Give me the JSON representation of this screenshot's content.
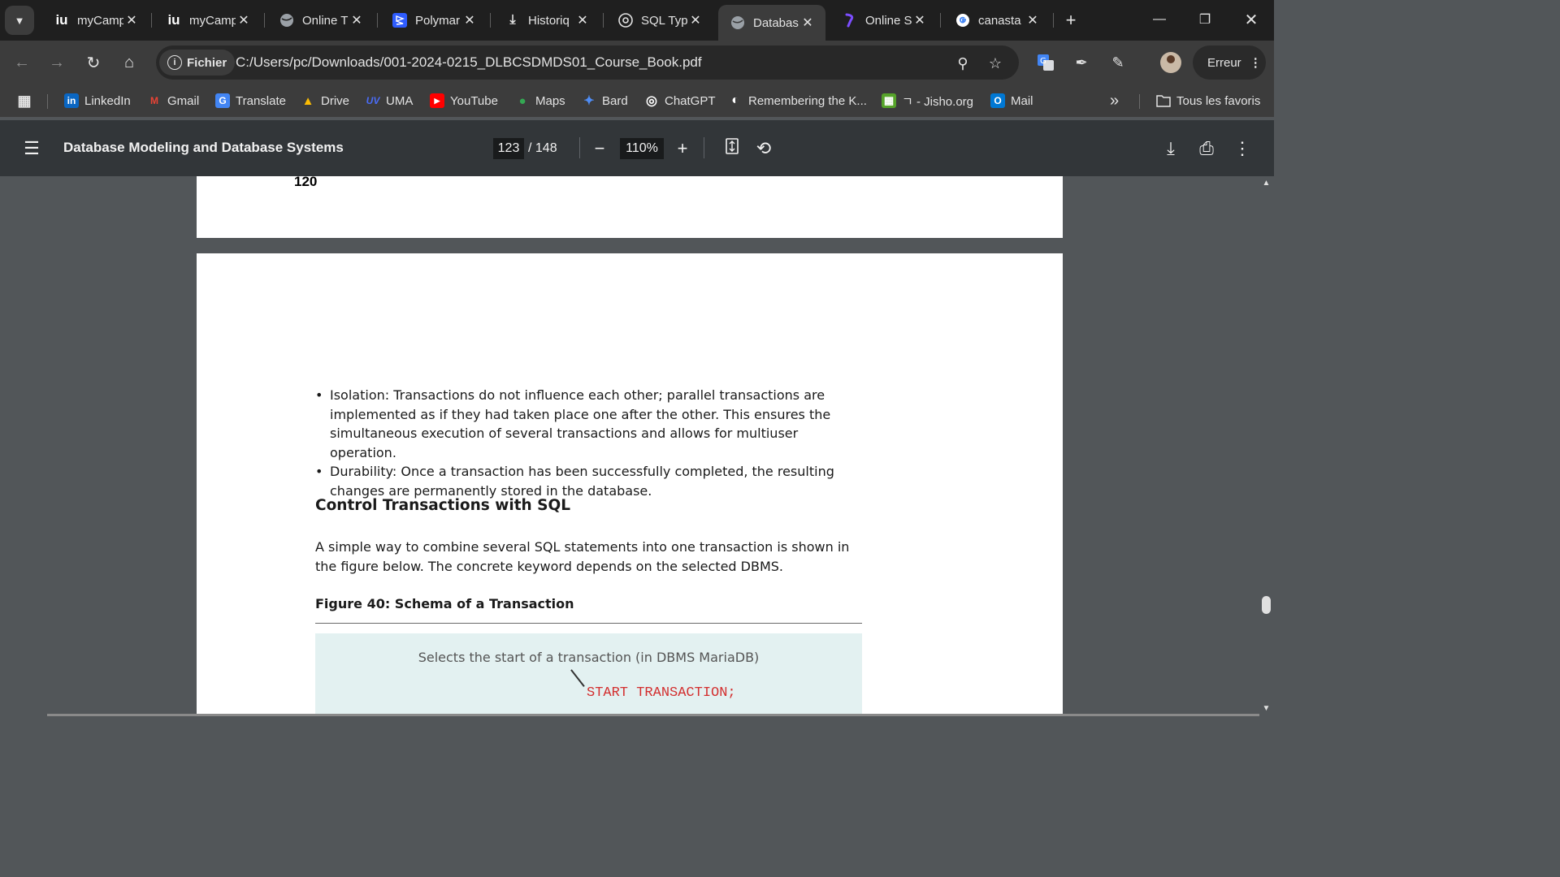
{
  "tabs": [
    {
      "title": "myCamp",
      "favicon": "iu"
    },
    {
      "title": "myCamp",
      "favicon": "iu"
    },
    {
      "title": "Online T",
      "favicon": "globe-icon"
    },
    {
      "title": "Polymar",
      "favicon": "polymarket-icon"
    },
    {
      "title": "Historiq",
      "favicon": "download-icon"
    },
    {
      "title": "SQL Typ",
      "favicon": "chatgpt-icon"
    },
    {
      "title": "Databas",
      "favicon": "globe-icon",
      "active": true
    },
    {
      "title": "Online S",
      "favicon": "brand-icon"
    },
    {
      "title": "canasta",
      "favicon": "google-icon"
    }
  ],
  "toolbar": {
    "chip_label": "Fichier",
    "url": "C:/Users/pc/Downloads/001-2024-0215_DLBCSDMDS01_Course_Book.pdf",
    "profile_button": "Erreur"
  },
  "bookmarks": [
    {
      "label": "LinkedIn",
      "icon": "in"
    },
    {
      "label": "Gmail",
      "icon": "M"
    },
    {
      "label": "Translate",
      "icon": "G"
    },
    {
      "label": "Drive",
      "icon": "▲"
    },
    {
      "label": "UMA",
      "icon": "UV"
    },
    {
      "label": "YouTube",
      "icon": "▶"
    },
    {
      "label": "Maps",
      "icon": "●"
    },
    {
      "label": "Bard",
      "icon": "✦"
    },
    {
      "label": "ChatGPT",
      "icon": "◎"
    },
    {
      "label": "Remembering the K...",
      "icon": "◐"
    },
    {
      "label": "ㄱ - Jisho.org",
      "icon": "▦"
    },
    {
      "label": "Mail",
      "icon": "O"
    }
  ],
  "bookmarks_more": "»",
  "all_bookmarks": "Tous les favoris",
  "pdf": {
    "title": "Database Modeling and Database Systems",
    "page_current": "123",
    "page_total": "/ 148",
    "zoom": "110%",
    "prev_page_number": "120",
    "bullet_isolation": "Isolation: Transactions do not influence each other; parallel transactions are implemented as if they had taken place one after the other. This ensures the simultaneous execution of several transactions and allows for multiuser operation.",
    "bullet_durability": "Durability: Once a transaction has been successfully completed, the resulting changes are permanently stored in the database.",
    "heading": "Control Transactions with SQL",
    "paragraph": "A simple way to combine several SQL statements into one transaction is shown in the figure below. The concrete keyword depends on the selected DBMS.",
    "figure_caption": "Figure 40: Schema of a Transaction",
    "figure_note": "Selects the start of a transaction (in DBMS MariaDB)",
    "figure_code": "START TRANSACTION;"
  },
  "colors": {
    "tabstrip_bg": "#1f1f1f",
    "toolbar_bg": "#3c3c3c",
    "pdf_toolbar_bg": "#323639",
    "viewer_bg": "#525659",
    "figure_bg": "#e3f1f1",
    "code_red": "#d32f2f"
  }
}
